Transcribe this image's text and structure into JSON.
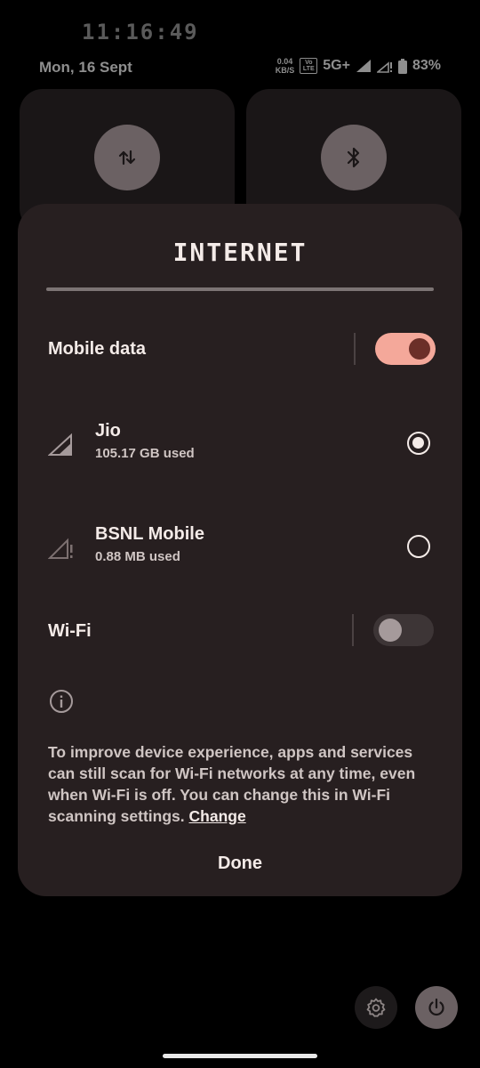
{
  "statusbar": {
    "time": "11:16:49",
    "date": "Mon, 16 Sept",
    "net_speed_value": "0.04",
    "net_speed_unit": "KB/S",
    "volte_top": "Vo",
    "volte_bottom": "LTE",
    "network_type": "5G+",
    "battery": "83%"
  },
  "tiles": {
    "left_icon": "data-transfer-arrows-icon",
    "right_icon": "bluetooth-icon"
  },
  "dialog": {
    "title": "INTERNET",
    "mobile_data": {
      "label": "Mobile data",
      "enabled": true
    },
    "sims": [
      {
        "name": "Jio",
        "usage": "105.17 GB used",
        "selected": true,
        "icon": "signal-icon"
      },
      {
        "name": "BSNL Mobile",
        "usage": "0.88 MB used",
        "selected": false,
        "icon": "signal-alert-icon"
      }
    ],
    "wifi": {
      "label": "Wi-Fi",
      "enabled": false
    },
    "info_text": "To improve device experience, apps and services can still scan for Wi-Fi networks at any time, even when Wi-Fi is off. You can change this in Wi-Fi scanning settings.",
    "info_link": "Change",
    "done_label": "Done"
  },
  "colors": {
    "accent": "#f4a89a",
    "dialog_bg": "#271f20"
  }
}
